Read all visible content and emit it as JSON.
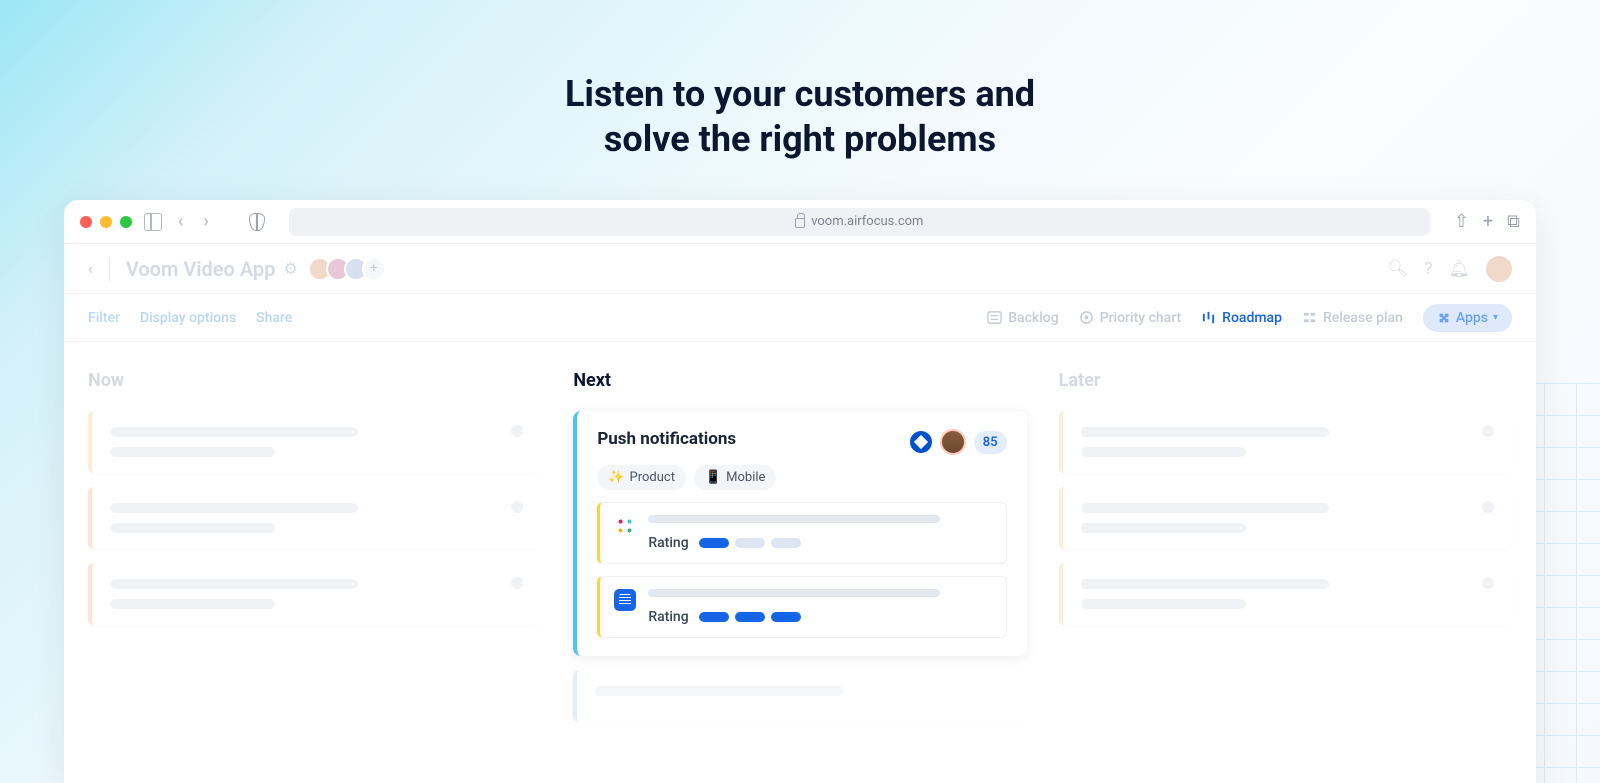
{
  "hero": {
    "title_line1": "Listen to your customers and",
    "title_line2": "solve the right problems"
  },
  "browser": {
    "url": "voom.airfocus.com"
  },
  "header": {
    "app_title": "Voom Video App"
  },
  "toolbar": {
    "filter": "Filter",
    "display_options": "Display options",
    "share": "Share",
    "views": {
      "backlog": "Backlog",
      "priority_chart": "Priority chart",
      "roadmap": "Roadmap",
      "release_plan": "Release plan"
    },
    "apps": "Apps"
  },
  "columns": {
    "now": "Now",
    "next": "Next",
    "later": "Later"
  },
  "card": {
    "title": "Push notifications",
    "score": "85",
    "tags": {
      "product_emoji": "✨",
      "product": "Product",
      "mobile_emoji": "📱",
      "mobile": "Mobile"
    },
    "rating_label": "Rating"
  }
}
